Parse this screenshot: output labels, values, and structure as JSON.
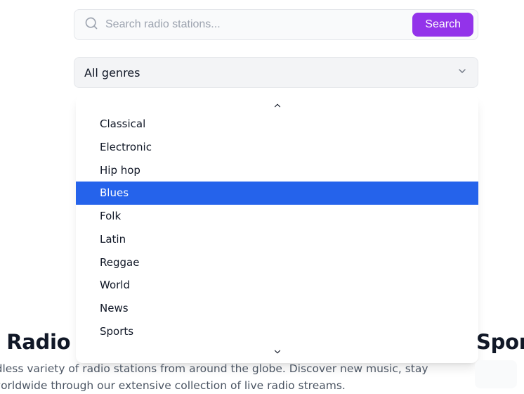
{
  "search": {
    "placeholder": "Search radio stations...",
    "button": "Search"
  },
  "genre_combo": {
    "selected": "All genres"
  },
  "genre_options": [
    {
      "label": "Classical",
      "highlight": false
    },
    {
      "label": "Electronic",
      "highlight": false
    },
    {
      "label": "Hip hop",
      "highlight": false
    },
    {
      "label": "Blues",
      "highlight": true
    },
    {
      "label": "Folk",
      "highlight": false
    },
    {
      "label": "Latin",
      "highlight": false
    },
    {
      "label": "Reggae",
      "highlight": false
    },
    {
      "label": "World",
      "highlight": false
    },
    {
      "label": "News",
      "highlight": false
    },
    {
      "label": "Sports",
      "highlight": false
    }
  ],
  "promo": {
    "heading_left": "bal Radio",
    "heading_right": "Sponso",
    "body": "an endless variety of radio stations from around the globe. Discover new music, stay ures worldwide through our extensive collection of live radio streams."
  }
}
